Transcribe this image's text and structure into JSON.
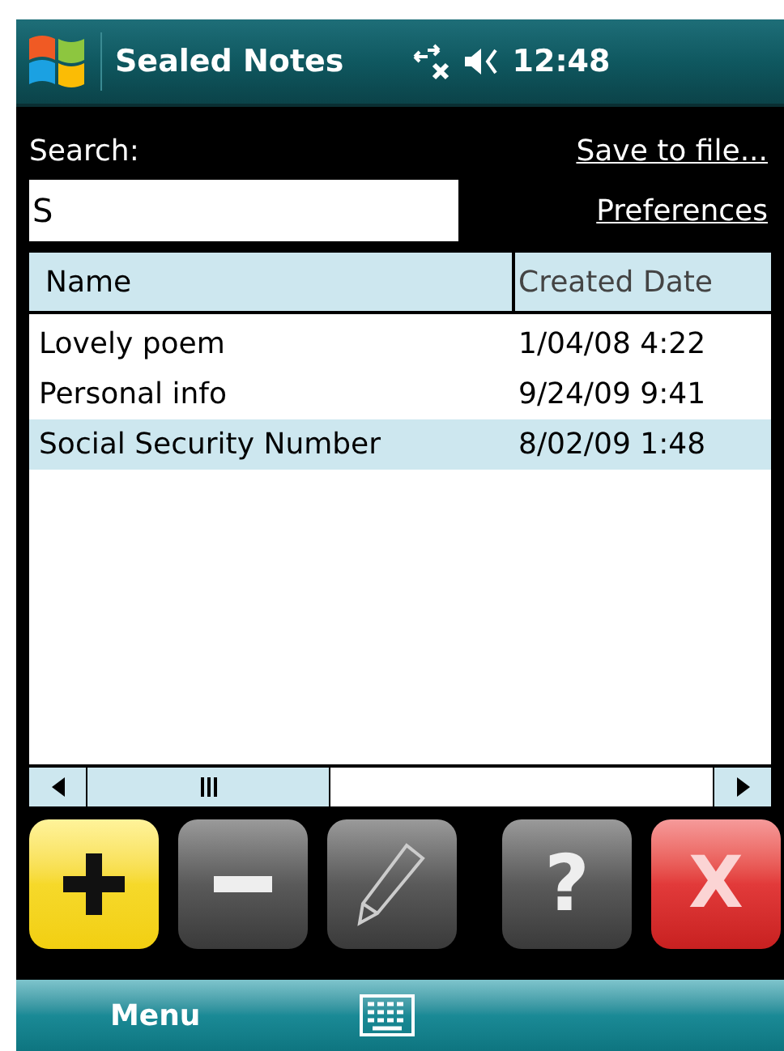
{
  "title_bar": {
    "title": "Sealed Notes",
    "time": "12:48"
  },
  "search": {
    "label": "Search:",
    "value": "S"
  },
  "links": [
    {
      "label": "Save to file..."
    },
    {
      "label": "Preferences"
    }
  ],
  "table": {
    "columns": [
      "Name",
      "Created Date"
    ],
    "rows": [
      {
        "name": "Lovely poem",
        "created": "1/04/08 4:22",
        "selected": false
      },
      {
        "name": "Personal info",
        "created": "9/24/09 9:41",
        "selected": false
      },
      {
        "name": "Social Security Number",
        "created": "8/02/09 1:48",
        "selected": true
      }
    ]
  },
  "toolbar": [
    {
      "kind": "add"
    },
    {
      "kind": "remove"
    },
    {
      "kind": "edit"
    },
    {
      "kind": "help",
      "label": "?"
    },
    {
      "kind": "close",
      "label": "X"
    }
  ],
  "soft_keys": {
    "left": "Menu"
  }
}
